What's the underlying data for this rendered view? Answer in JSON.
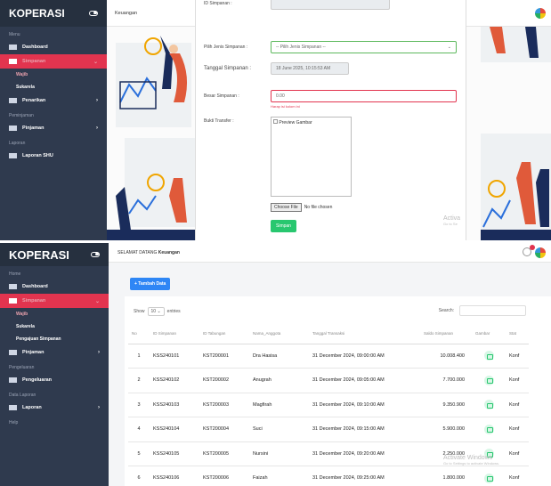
{
  "screen1": {
    "brand": "KOPERASI",
    "topbar_user": "Keuangan",
    "sidebar": [
      {
        "type": "section",
        "label": "Menu"
      },
      {
        "type": "nav",
        "label": "Dashboard"
      },
      {
        "type": "nav",
        "label": "Simpanan",
        "active": true
      },
      {
        "type": "sub",
        "label": "Wajib",
        "hl": true
      },
      {
        "type": "sub",
        "label": "Sukarela"
      },
      {
        "type": "nav",
        "label": "Penarikan",
        "chev": true
      },
      {
        "type": "section",
        "label": "Peminjaman"
      },
      {
        "type": "nav",
        "label": "Pinjaman",
        "chev": true
      },
      {
        "type": "section",
        "label": "Laporan"
      },
      {
        "type": "nav",
        "label": "Laporan SHU"
      }
    ],
    "form": {
      "id_label": "ID Simpanan :",
      "jenis_label": "Pilih Jenis Simpanan :",
      "jenis_placeholder": "-- Pilih Jenis Simpanan --",
      "tanggal_label": "Tanggal Simpanan :",
      "tanggal_value": "18 June 2025, 10:15:53 AM",
      "besar_label": "Besar Simpanan :",
      "besar_value": "0.00",
      "besar_error": "Harap isi kolom ini",
      "bukti_label": "Bukti Transfer :",
      "preview_alt": "Preview Gambar",
      "choose_file": "Choose File",
      "no_file": "No file chosen",
      "submit": "Simpan"
    },
    "watermark": {
      "title": "Activa",
      "sub": "Go to Se"
    }
  },
  "screen2": {
    "brand": "KOPERASI",
    "welcome": "SELAMAT DATANG",
    "user": "Keuangan",
    "sidebar": [
      {
        "type": "section",
        "label": "Home"
      },
      {
        "type": "nav",
        "label": "Dashboard"
      },
      {
        "type": "nav",
        "label": "Simpanan",
        "active": true
      },
      {
        "type": "sub",
        "label": "Wajib",
        "hl": true
      },
      {
        "type": "sub",
        "label": "Sukarela"
      },
      {
        "type": "sub",
        "label": "Pengajuan Simpanan"
      },
      {
        "type": "nav",
        "label": "Pinjaman",
        "chev": true
      },
      {
        "type": "section",
        "label": "Pengeluaran"
      },
      {
        "type": "nav",
        "label": "Pengeluaran"
      },
      {
        "type": "section",
        "label": "Data Laporan"
      },
      {
        "type": "nav",
        "label": "Laporan",
        "chev": true
      },
      {
        "type": "section",
        "label": "Help"
      }
    ],
    "add_button": "+ Tambah Data",
    "show_label": "Show",
    "show_value": "10",
    "entries_label": "entries",
    "search_label": "Search:",
    "columns": [
      "No",
      "ID Simpanan",
      "ID Tabungan",
      "Nama_Anggota",
      "Tanggal Transaksi",
      "Saldo Simpanan",
      "Gambar",
      "Stat"
    ],
    "rows": [
      [
        "1",
        "KSS240101",
        "KST200001",
        "Dra Hasisa",
        "31 December 2024, 09:00:00 AM",
        "10.008.400",
        "",
        "Konf"
      ],
      [
        "2",
        "KSS240102",
        "KST200002",
        "Anugrah",
        "31 December 2024, 09:05:00 AM",
        "7.700.000",
        "",
        "Konf"
      ],
      [
        "3",
        "KSS240103",
        "KST200003",
        "Magfirah",
        "31 December 2024, 09:10:00 AM",
        "9.350.900",
        "",
        "Konf"
      ],
      [
        "4",
        "KSS240104",
        "KST200004",
        "Suci",
        "31 December 2024, 09:15:00 AM",
        "5.900.000",
        "",
        "Konf"
      ],
      [
        "5",
        "KSS240105",
        "KST200005",
        "Nursini",
        "31 December 2024, 09:20:00 AM",
        "2.250.000",
        "",
        "Konf"
      ],
      [
        "6",
        "KSS240106",
        "KST200006",
        "Faizah",
        "31 December 2024, 09:25:00 AM",
        "1.800.000",
        "",
        "Konf"
      ]
    ],
    "watermark": {
      "title": "Activate Windows",
      "sub": "Go to Settings to activate Windows."
    }
  }
}
